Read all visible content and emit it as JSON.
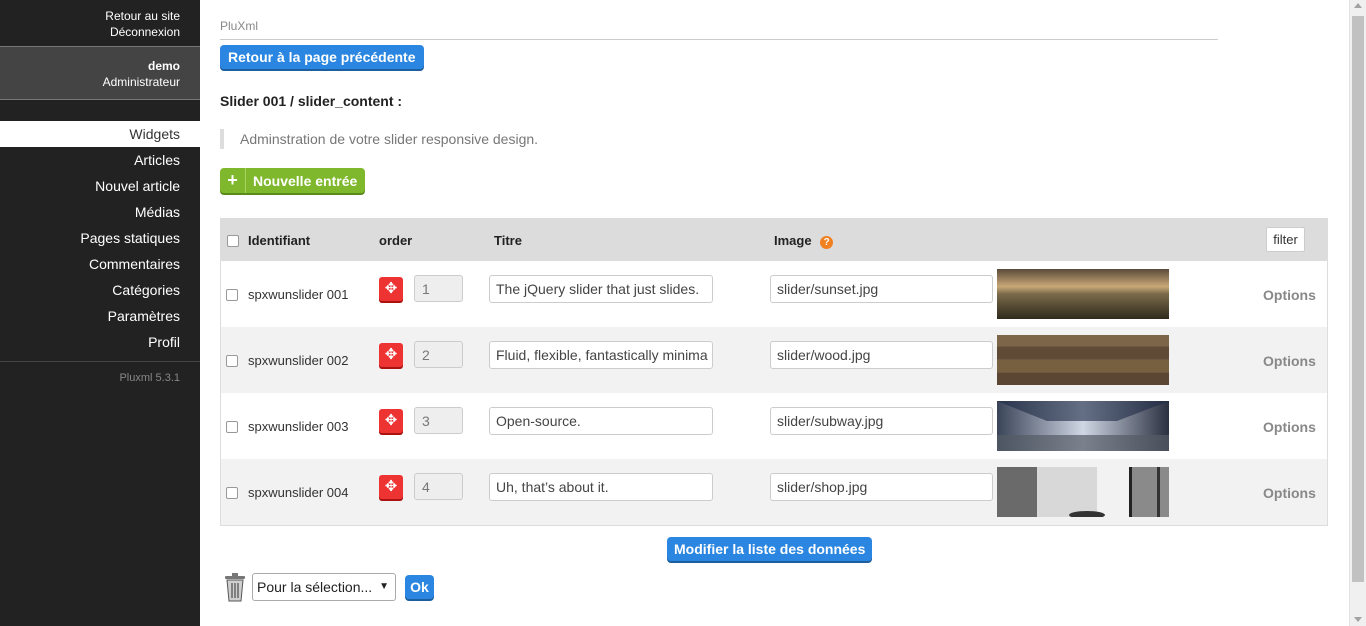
{
  "sidebar": {
    "top_links": [
      "Retour au site",
      "Déconnexion"
    ],
    "user_name": "demo",
    "user_role": "Administrateur",
    "menu": [
      "Widgets",
      "Articles",
      "Nouvel article",
      "Médias",
      "Pages statiques",
      "Commentaires",
      "Catégories",
      "Paramètres",
      "Profil"
    ],
    "active_item": "Widgets",
    "version": "Pluxml 5.3.1"
  },
  "main": {
    "breadcrumb": "PluXml",
    "back_button": "Retour à la page précédente",
    "heading": "Slider 001 / slider_content :",
    "description": "Adminstration de votre slider responsive design.",
    "new_entry_button": "Nouvelle entrée",
    "new_entry_icon": "plus-icon"
  },
  "table": {
    "headers": {
      "identifiant": "Identifiant",
      "order": "order",
      "titre": "Titre",
      "image": "Image",
      "filter": "filter"
    },
    "rows": [
      {
        "id": "spxwunslider 001",
        "order": "1",
        "title": "The jQuery slider that just slides.",
        "image": "slider/sunset.jpg",
        "thumb": "sunset",
        "options": "Options"
      },
      {
        "id": "spxwunslider 002",
        "order": "2",
        "title": "Fluid, flexible, fantastically minima",
        "image": "slider/wood.jpg",
        "thumb": "wood",
        "options": "Options"
      },
      {
        "id": "spxwunslider 003",
        "order": "3",
        "title": "Open-source.",
        "image": "slider/subway.jpg",
        "thumb": "subway",
        "options": "Options"
      },
      {
        "id": "spxwunslider 004",
        "order": "4",
        "title": "Uh, that’s about it.",
        "image": "slider/shop.jpg",
        "thumb": "shop",
        "options": "Options"
      }
    ]
  },
  "footer": {
    "modify_button": "Modifier la liste des données",
    "selection_select": "Pour la sélection...",
    "ok_button": "Ok"
  },
  "colors": {
    "accent_blue": "#2a86e0",
    "green": "#7fb82d",
    "sidebar_bg": "#222222",
    "move_red": "#ee3333"
  }
}
